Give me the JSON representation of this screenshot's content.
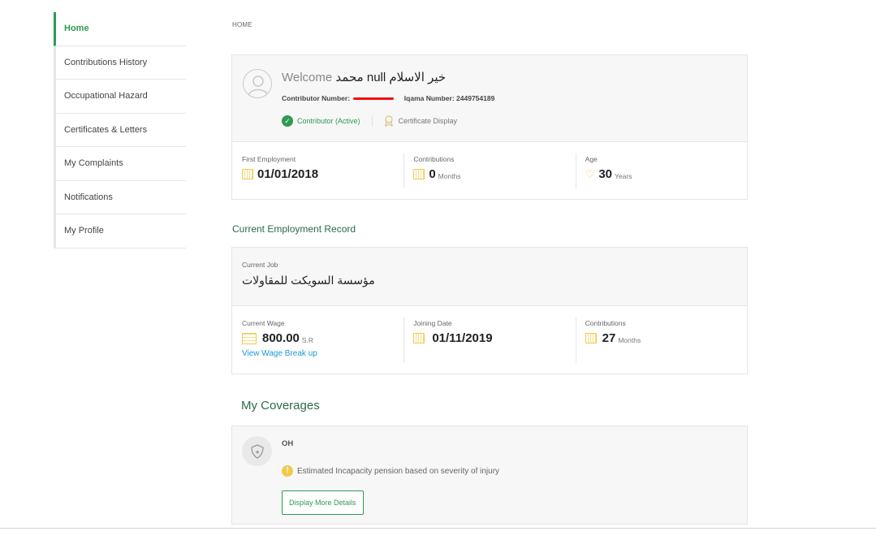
{
  "sidebar": {
    "items": [
      {
        "label": "Home",
        "active": true
      },
      {
        "label": "Contributions History"
      },
      {
        "label": "Occupational Hazard"
      },
      {
        "label": "Certificates & Letters"
      },
      {
        "label": "My Complaints"
      },
      {
        "label": "Notifications"
      },
      {
        "label": "My Profile"
      }
    ]
  },
  "breadcrumb": "HOME",
  "profile": {
    "welcome_label": "Welcome",
    "name": "محمد null خير الاسلام",
    "contributor_number_label": "Contributor Number:",
    "iqama_label": "Iqama Number:",
    "iqama_value": "2449754189",
    "status": "Contributor (Active)",
    "certificate_display": "Certificate Display",
    "stats": [
      {
        "label": "First Employment",
        "value": "01/01/2018",
        "unit": "",
        "icon": "calendar-icon"
      },
      {
        "label": "Contributions",
        "value": "0",
        "unit": "Months",
        "icon": "calendar-icon"
      },
      {
        "label": "Age",
        "value": "30",
        "unit": "Years",
        "icon": "heart-icon"
      }
    ]
  },
  "employment": {
    "section_title": "Current Employment Record",
    "current_job_label": "Current Job",
    "current_job_value": "مؤسسة السويكت للمقاولات",
    "stats": [
      {
        "label": "Current Wage",
        "value": "800.00",
        "unit": "S.R",
        "icon": "money-icon",
        "link": "View Wage Break up"
      },
      {
        "label": "Joining Date",
        "value": "01/11/2019",
        "unit": "",
        "icon": "calendar-icon"
      },
      {
        "label": "Contributions",
        "value": "27",
        "unit": "Months",
        "icon": "calendar-icon"
      }
    ]
  },
  "coverages": {
    "title": "My Coverages",
    "code": "OH",
    "description": "Estimated Incapacity pension based on severity of injury",
    "button": "Display More Details"
  },
  "colors": {
    "accent": "#2f9a54",
    "link": "#1b9ad6",
    "icon": "#f2c94c"
  }
}
